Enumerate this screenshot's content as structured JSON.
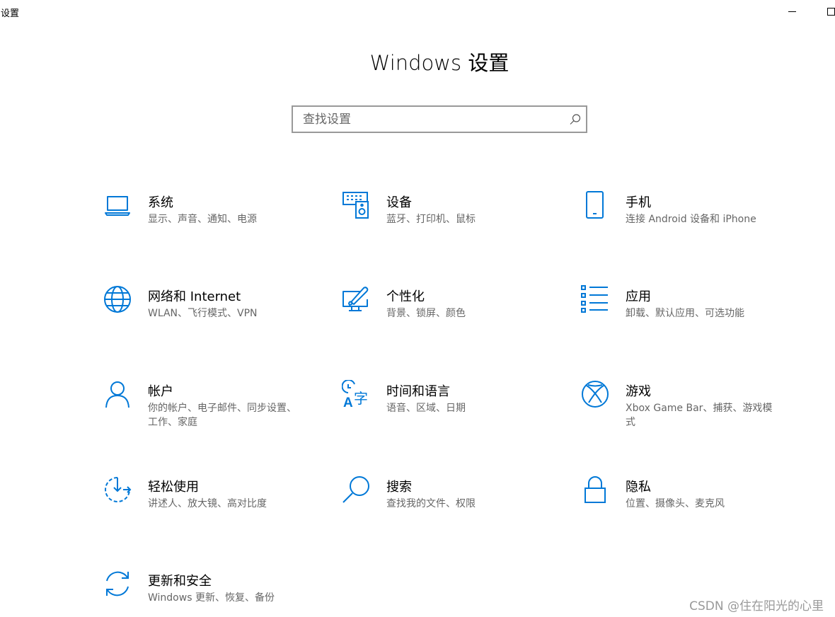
{
  "window": {
    "title": "设置"
  },
  "header": {
    "title": "Windows 设置"
  },
  "search": {
    "placeholder": "查找设置",
    "value": ""
  },
  "tiles": [
    {
      "title": "系统",
      "desc": "显示、声音、通知、电源",
      "icon": "laptop-icon"
    },
    {
      "title": "设备",
      "desc": "蓝牙、打印机、鼠标",
      "icon": "devices-icon"
    },
    {
      "title": "手机",
      "desc": "连接 Android 设备和 iPhone",
      "icon": "phone-icon"
    },
    {
      "title": "网络和 Internet",
      "desc": "WLAN、飞行模式、VPN",
      "icon": "globe-icon"
    },
    {
      "title": "个性化",
      "desc": "背景、锁屏、颜色",
      "icon": "personalization-icon"
    },
    {
      "title": "应用",
      "desc": "卸载、默认应用、可选功能",
      "icon": "apps-list-icon"
    },
    {
      "title": "帐户",
      "desc": "你的帐户、电子邮件、同步设置、工作、家庭",
      "icon": "person-icon"
    },
    {
      "title": "时间和语言",
      "desc": "语音、区域、日期",
      "icon": "time-language-icon"
    },
    {
      "title": "游戏",
      "desc": "Xbox Game Bar、捕获、游戏模式",
      "icon": "xbox-icon"
    },
    {
      "title": "轻松使用",
      "desc": "讲述人、放大镜、高对比度",
      "icon": "ease-of-access-icon"
    },
    {
      "title": "搜索",
      "desc": "查找我的文件、权限",
      "icon": "search-magnifier-icon"
    },
    {
      "title": "隐私",
      "desc": "位置、摄像头、麦克风",
      "icon": "lock-icon"
    },
    {
      "title": "更新和安全",
      "desc": "Windows 更新、恢复、备份",
      "icon": "update-icon"
    }
  ],
  "watermark": "CSDN @住在阳光的心里",
  "colors": {
    "accent": "#0078d7"
  }
}
